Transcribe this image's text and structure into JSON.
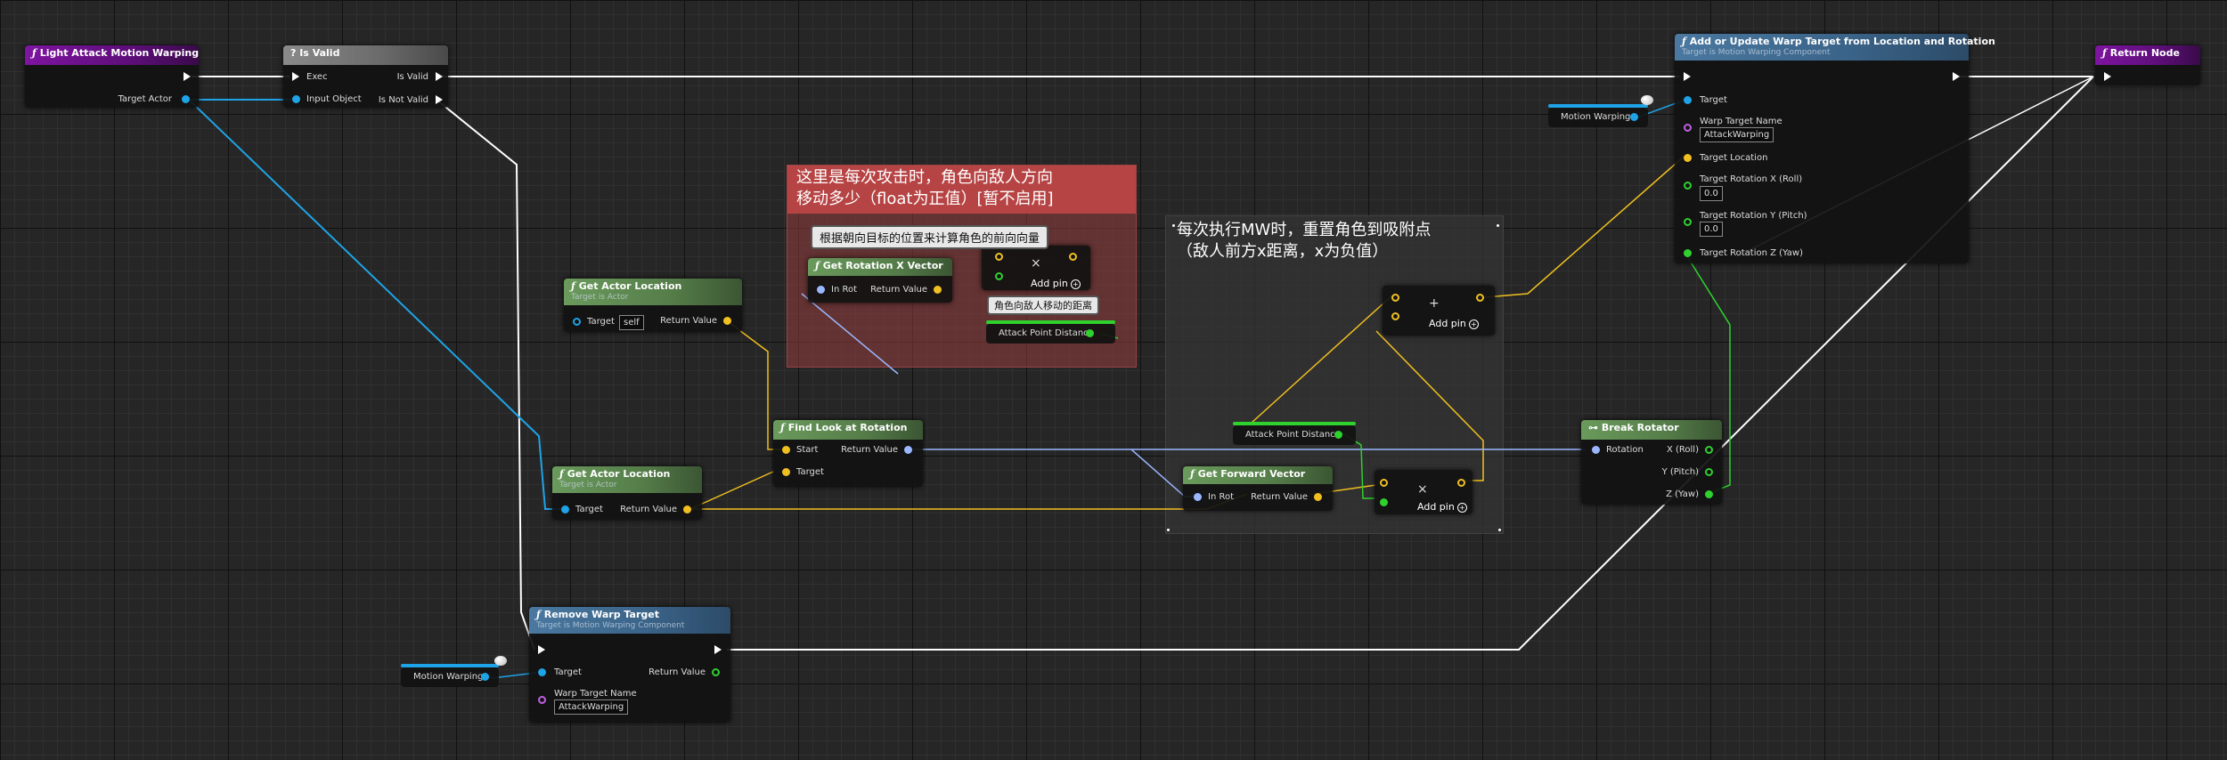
{
  "nodes": {
    "entry": {
      "title": "Light Attack Motion Warping",
      "target_actor": "Target Actor"
    },
    "is_valid": {
      "title": "Is Valid",
      "icon": "question-icon",
      "exec": "Exec",
      "is_valid": "Is Valid",
      "input_object": "Input Object",
      "is_not_valid": "Is Not Valid"
    },
    "return_node": {
      "title": "Return Node"
    },
    "add_warp": {
      "title": "Add or Update Warp Target from Location and Rotation",
      "subtitle": "Target is Motion Warping Component",
      "target": "Target",
      "warp_target_name_label": "Warp Target Name",
      "warp_target_name_value": "AttackWarping",
      "target_location": "Target Location",
      "rot_x_label": "Target Rotation X (Roll)",
      "rot_x_value": "0.0",
      "rot_y_label": "Target Rotation Y (Pitch)",
      "rot_y_value": "0.0",
      "rot_z_label": "Target Rotation Z (Yaw)"
    },
    "get_actor_loc_1": {
      "title": "Get Actor Location",
      "subtitle": "Target is Actor",
      "target": "Target",
      "target_value": "self",
      "return_value": "Return Value"
    },
    "get_actor_loc_2": {
      "title": "Get Actor Location",
      "subtitle": "Target is Actor",
      "target": "Target",
      "return_value": "Return Value"
    },
    "find_look": {
      "title": "Find Look at Rotation",
      "start": "Start",
      "target": "Target",
      "return_value": "Return Value"
    },
    "get_rot_x": {
      "title": "Get Rotation X Vector",
      "in_rot": "In Rot",
      "return_value": "Return Value"
    },
    "get_forward": {
      "title": "Get Forward Vector",
      "in_rot": "In Rot",
      "return_value": "Return Value"
    },
    "break_rot": {
      "title": "Break Rotator",
      "rotation": "Rotation",
      "x": "X (Roll)",
      "y": "Y (Pitch)",
      "z": "Z (Yaw)"
    },
    "remove_warp": {
      "title": "Remove Warp Target",
      "subtitle": "Target is Motion Warping Component",
      "target": "Target",
      "return_value": "Return Value",
      "warp_target_name_label": "Warp Target Name",
      "warp_target_name_value": "AttackWarping"
    }
  },
  "variables": {
    "motion_warping_top": "Motion Warping",
    "motion_warping_bottom": "Motion Warping",
    "attack_point_distance_1": "Attack Point Distance",
    "attack_point_distance_2": "Attack Point Distance"
  },
  "operators": {
    "add_pin": "Add pin",
    "multiply_symbol": "×",
    "plus_symbol": "+"
  },
  "comments": {
    "red": {
      "title_line1": "这里是每次攻击时，角色向敌人方向",
      "title_line2": "移动多少（float为正值）[暂不启用]"
    },
    "gray": {
      "title_line1": "每次执行MW时，重置角色到吸附点",
      "title_line2": "（敌人前方x距离，x为负值）"
    },
    "bubble_direction": "根据朝向目标的位置来计算角色的前向向量",
    "bubble_distance": "角色向敌人移动的距离"
  },
  "colors": {
    "exec": "#ffffff",
    "object": "#1ea3e6",
    "vector": "#f0c020",
    "rotator": "#9bb7ff",
    "float": "#2fd12f",
    "name": "#c060e0"
  }
}
